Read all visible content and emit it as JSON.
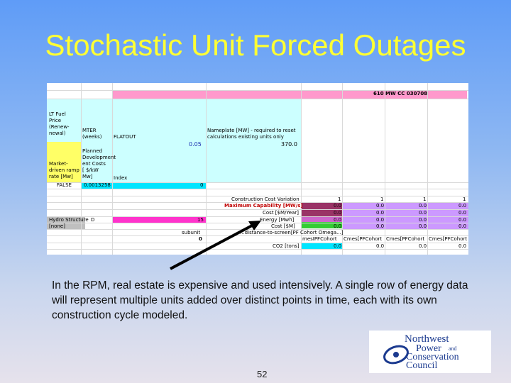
{
  "slide": {
    "title": "Stochastic Unit Forced Outages",
    "caption": "In the RPM, real estate is expensive and used intensively.  A single row of energy data will represent multiple units added over distinct points in time, each with its own construction cycle modeled.",
    "page_number": "52"
  },
  "sheet": {
    "header": "610 MW CC 030708",
    "left_labels": [
      "LT Fuel",
      "Price",
      "(Renew-",
      "newal)"
    ],
    "col_mter": [
      "MTER",
      "(weeks)"
    ],
    "col_flatout": "FLATOUT",
    "nameplate_note": [
      "Nameplate [MW] - required to reset",
      "calculations existing units only"
    ],
    "val_005": "0.05",
    "val_370": "370.0",
    "planned_dev": [
      "Planned",
      "Development",
      "ent Costs",
      "[ $/kW",
      "Mw]"
    ],
    "market_driven": [
      "Market-",
      "driven ramp",
      "rate [Mw]"
    ],
    "index_label": "Index",
    "false_val": "FALSE",
    "small_val": "0.0013258",
    "zero_val": "0",
    "row_labels": [
      "Construction Cost Variation",
      "Maximum Capability [MW/s]",
      "Cost [$M/Year]",
      "Energy [Mwh]",
      "Cost [$M]",
      "...distance-to-screen[PF Cohort Omega...]",
      "...mes[PF Cohort Omes[PF Cohort...]",
      "CO2 [tons]"
    ],
    "hydro_label": "Hydro Structure",
    "hydro_none": "[none]",
    "d_label": "D",
    "num_15": "15",
    "subunit": "subunit",
    "row_ones": [
      "1",
      "1",
      "1",
      "1"
    ],
    "zeros": [
      "0.0",
      "0.0",
      "0.0",
      "0.0"
    ],
    "cohort": [
      "mesIPFCohort",
      "Cmes[PFCohort",
      "Cmes[PFCohort",
      "Cmes[PFCohort C"
    ],
    "zero_small": "0"
  },
  "logo": {
    "line1": "Northwest",
    "line2": "Power",
    "line2b": "and",
    "line3": "Conservation",
    "line4": "Council"
  },
  "colors": {
    "title": "#ffff33",
    "pink_band": "#ff99cc",
    "magenta": "#ff33cc",
    "cyan": "#00e5ff",
    "light_cyan": "#ccffff",
    "yellow": "#ffff66",
    "purple_dark": "#993366",
    "purple_mid": "#cc66cc",
    "lavender": "#cc99ff",
    "green": "#33cc33",
    "gray": "#bfbfbf"
  }
}
